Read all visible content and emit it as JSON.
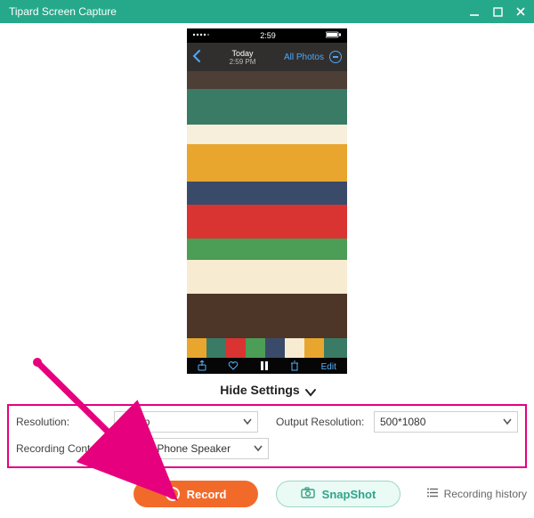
{
  "titlebar": {
    "title": "Tipard Screen Capture"
  },
  "phone": {
    "time_left": "2:59",
    "today": "Today",
    "subtime": "2:59 PM",
    "all_photos": "All Photos",
    "edit": "Edit"
  },
  "hide_settings_label": "Hide Settings",
  "settings": {
    "resolution_label": "Resolution:",
    "resolution_value": "1080p",
    "output_label": "Output Resolution:",
    "output_value": "500*1080",
    "recording_content_label": "Recording Content:",
    "recording_content_value": "Screen,Phone Speaker"
  },
  "actions": {
    "record": "Record",
    "snapshot": "SnapShot",
    "history": "Recording history"
  },
  "colors": {
    "accent": "#26a98b",
    "record": "#f26a2a",
    "highlight": "#e6007e"
  }
}
